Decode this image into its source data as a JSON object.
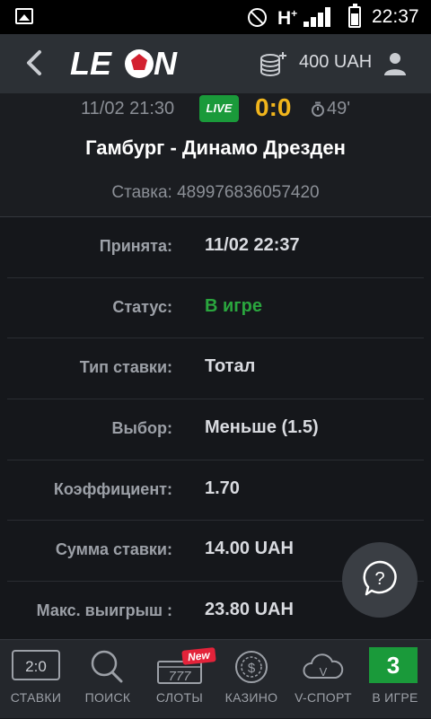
{
  "status_bar": {
    "network": "H",
    "network_sup": "+",
    "time": "22:37"
  },
  "header": {
    "logo_text": "LEON",
    "balance": "400 UAH"
  },
  "match": {
    "datetime": "11/02 21:30",
    "live_badge": "LIVE",
    "score": "0:0",
    "minute": "49'",
    "teams": "Гамбург - Динамо Дрезден",
    "bet_id": "Ставка: 489976836057420"
  },
  "details": [
    {
      "label": "Принята:",
      "value": "11/02 22:37"
    },
    {
      "label": "Статус:",
      "value": "В игре"
    },
    {
      "label": "Тип ставки:",
      "value": "Тотал"
    },
    {
      "label": "Выбор:",
      "value": "Меньше (1.5)"
    },
    {
      "label": "Коэффициент:",
      "value": "1.70"
    },
    {
      "label": "Сумма ставки:",
      "value": "14.00 UAH"
    },
    {
      "label": "Макс. выигрыш :",
      "value": "23.80 UAH"
    }
  ],
  "nav": {
    "bets_icon_text": "2:0",
    "bets": "СТАВКИ",
    "search": "ПОИСК",
    "slots": "СЛОТЫ",
    "slots_icon_text": "777",
    "new_badge": "New",
    "casino": "КАЗИНО",
    "vsport": "V-СПОРТ",
    "vsport_icon_text": "V",
    "ingame": "В ИГРЕ",
    "ingame_count": "3"
  },
  "colors": {
    "accent_green": "#1a9a3a",
    "score_yellow": "#f1b51c",
    "status_green": "#2aa63e",
    "badge_red": "#e3233a"
  }
}
